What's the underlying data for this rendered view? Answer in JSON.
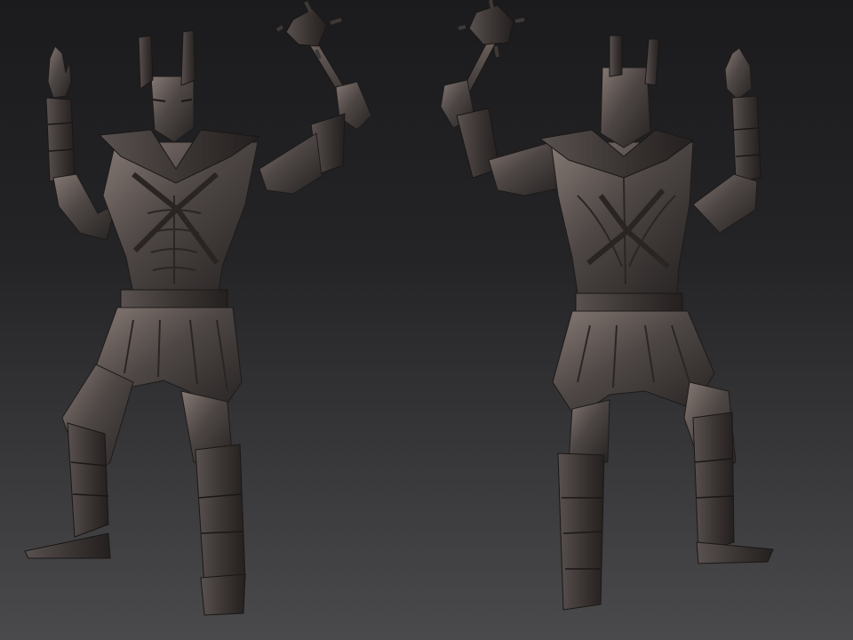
{
  "viewport": {
    "background_top": "#1b1b1d",
    "background_bottom": "#4a4a4c"
  },
  "material": {
    "base": "#4a4441",
    "shade": "#2b2726",
    "highlight": "#8a7f7a",
    "rim": "#6e5c58"
  },
  "figures": [
    {
      "view": "front"
    },
    {
      "view": "back"
    }
  ]
}
